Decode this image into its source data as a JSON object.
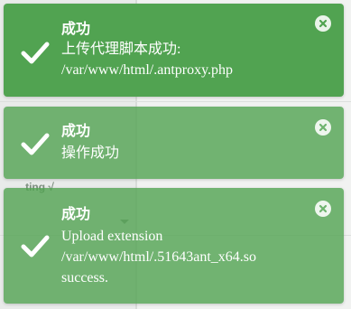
{
  "background": {
    "partial_text": "ting √"
  },
  "toasts": [
    {
      "type": "success",
      "title": "成功",
      "message": "上传代理脚本成功:\n/var/www/html/.antproxy.php",
      "icon": "check-icon",
      "close_icon": "close-icon",
      "color": "#51a351"
    },
    {
      "type": "success",
      "title": "成功",
      "message": "操作成功",
      "icon": "check-icon",
      "close_icon": "close-icon",
      "color": "#51a351"
    },
    {
      "type": "success",
      "title": "成功",
      "message": "Upload extension\n/var/www/html/.51643ant_x64.so\nsuccess.",
      "icon": "check-icon",
      "close_icon": "close-icon",
      "color": "#51a351"
    }
  ]
}
